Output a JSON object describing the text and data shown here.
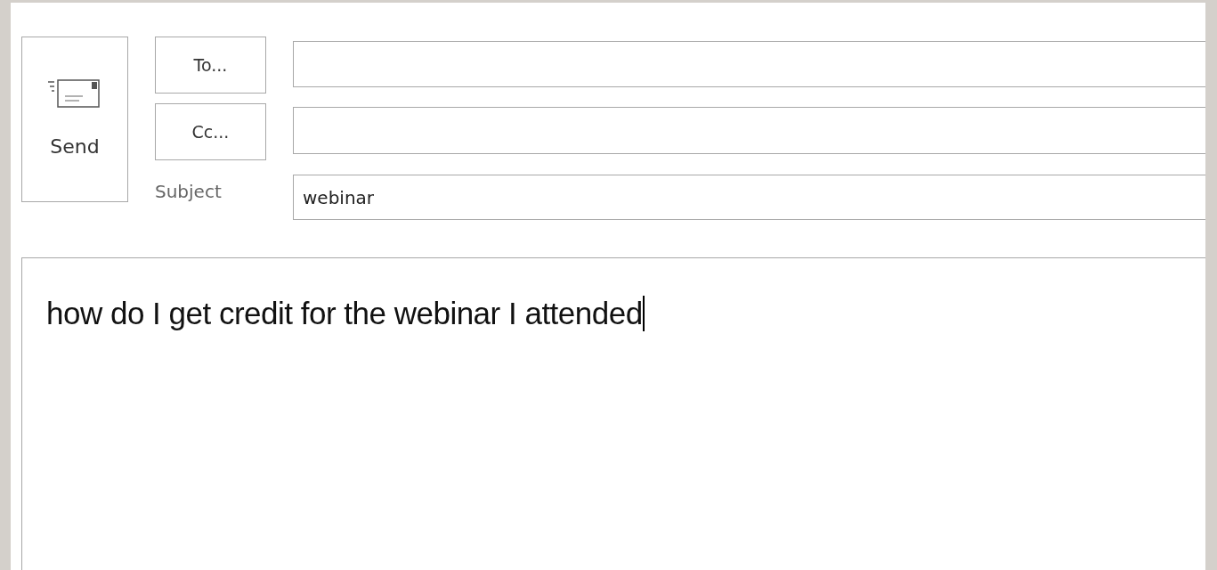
{
  "send_button": {
    "label": "Send"
  },
  "to_button": {
    "label": "To..."
  },
  "cc_button": {
    "label": "Cc..."
  },
  "subject": {
    "label": "Subject",
    "value": "webinar"
  },
  "body": {
    "text": "how do I get credit for the webinar I attended",
    "focused": true
  }
}
